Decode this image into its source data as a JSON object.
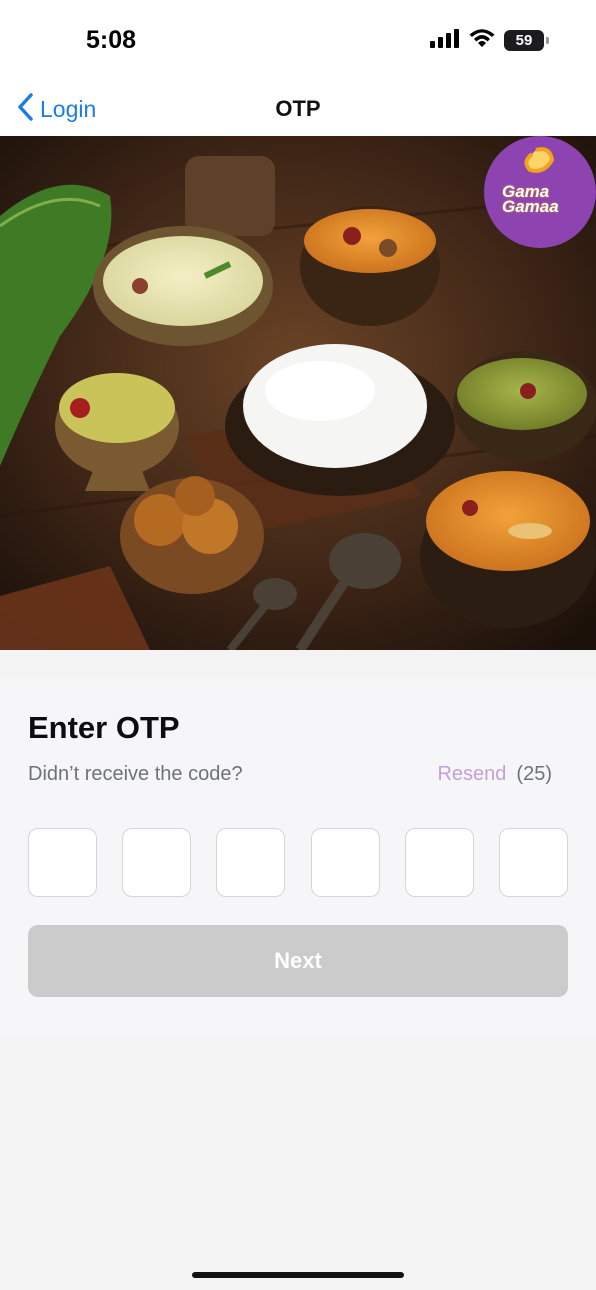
{
  "status_bar": {
    "time": "5:08",
    "battery": "59",
    "icons": [
      "signal-icon",
      "wifi-icon",
      "battery-icon"
    ]
  },
  "nav": {
    "back_label": "Login",
    "title": "OTP"
  },
  "hero": {
    "logo_text": "Gama Gamaa",
    "brand_color": "#8e44b0"
  },
  "otp": {
    "title": "Enter OTP",
    "prompt": "Didn’t receive the code?",
    "resend_label": "Resend",
    "countdown": "(25)",
    "digits": [
      "",
      "",
      "",
      "",
      "",
      ""
    ],
    "next_label": "Next"
  },
  "colors": {
    "accent": "#1a7ee8",
    "resend": "#c4a1d4",
    "disabled_button": "#cbcbcb"
  }
}
